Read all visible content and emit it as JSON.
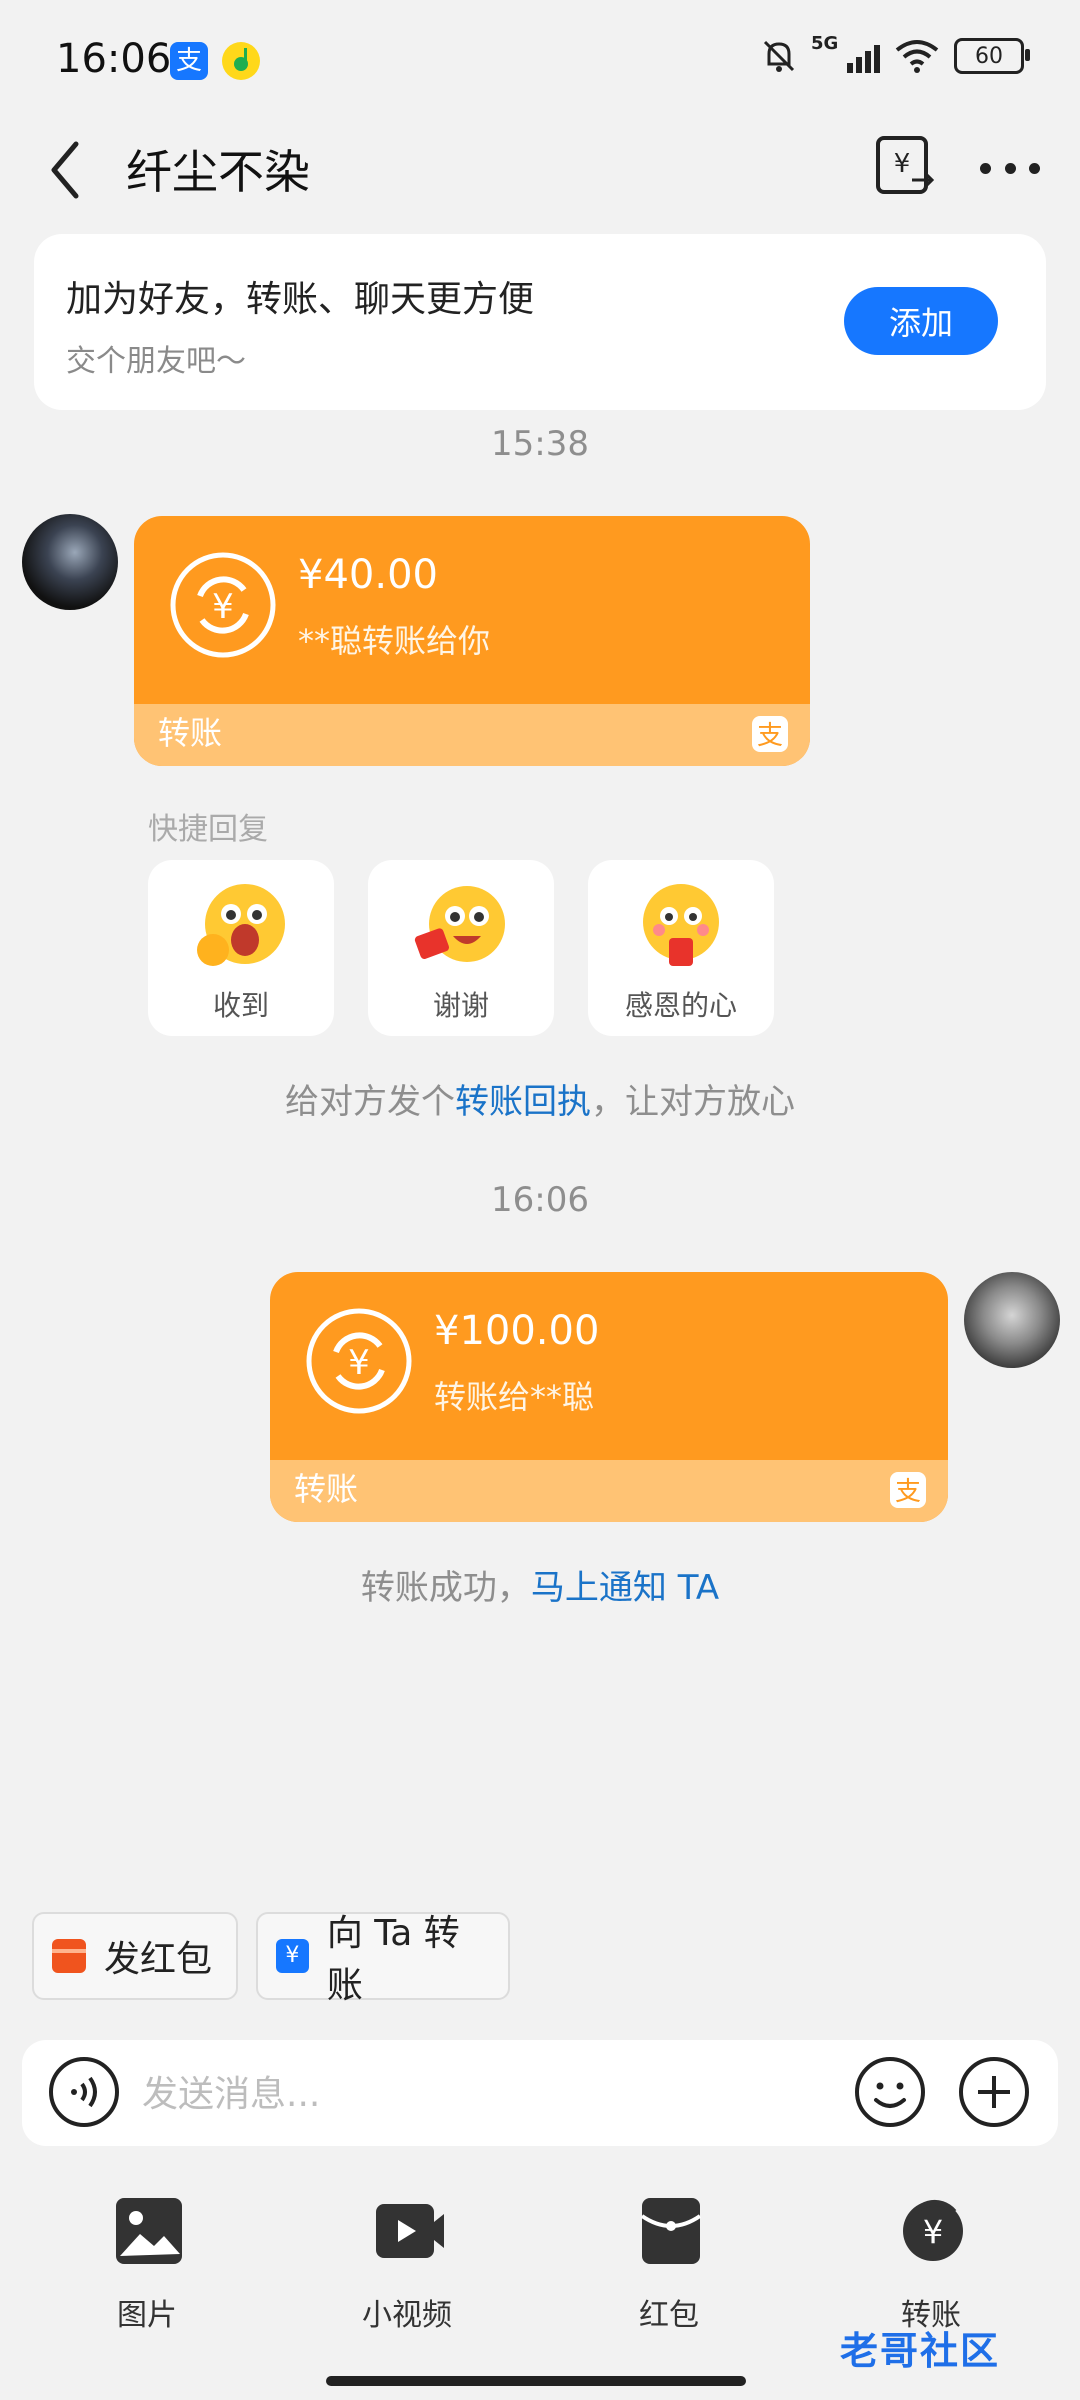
{
  "status_bar": {
    "time": "16:06",
    "network": "5G",
    "battery": "60",
    "icons": [
      "alipay-app-icon",
      "music-app-icon",
      "mute-bell-icon",
      "signal-icon",
      "wifi-icon",
      "battery-icon"
    ]
  },
  "header": {
    "title": "纤尘不染",
    "back_icon": "chevron-left-icon",
    "transfer_icon": "yuan-transfer-icon",
    "more_icon": "more-dots-icon"
  },
  "friend_card": {
    "title": "加为好友，转账、聊天更方便",
    "subtitle": "交个朋友吧～",
    "add_button": "添加"
  },
  "messages": [
    {
      "timestamp": "15:38",
      "direction": "incoming",
      "amount": "¥40.00",
      "description": "**聪转账给你",
      "label": "转账"
    },
    {
      "timestamp": "16:06",
      "direction": "outgoing",
      "amount": "¥100.00",
      "description": "转账给**聪",
      "label": "转账"
    }
  ],
  "quick_reply": {
    "label": "快捷回复",
    "items": [
      {
        "label": "收到",
        "icon": "ok-emoji-icon"
      },
      {
        "label": "谢谢",
        "icon": "red-packet-emoji-icon"
      },
      {
        "label": "感恩的心",
        "icon": "blush-emoji-icon"
      }
    ]
  },
  "receipt_hint": {
    "prefix": "给对方发个",
    "link": "转账回执",
    "suffix": "，让对方放心"
  },
  "success_hint": {
    "prefix": "转账成功，",
    "link": "马上通知 TA"
  },
  "chips": [
    {
      "label": "发红包",
      "icon": "red-packet-icon"
    },
    {
      "label": "向 Ta 转账",
      "icon": "transfer-card-icon"
    }
  ],
  "input": {
    "placeholder": "发送消息..."
  },
  "toolbar": [
    {
      "label": "图片",
      "icon": "image-icon"
    },
    {
      "label": "小视频",
      "icon": "video-icon"
    },
    {
      "label": "红包",
      "icon": "red-packet-icon"
    },
    {
      "label": "转账",
      "icon": "yuan-circle-icon"
    }
  ],
  "watermark": "老哥社区",
  "colors": {
    "accent_blue": "#1677ff",
    "transfer_orange": "#ff9a1f",
    "transfer_footer": "#ffc374",
    "link_blue": "#1a73c8"
  }
}
